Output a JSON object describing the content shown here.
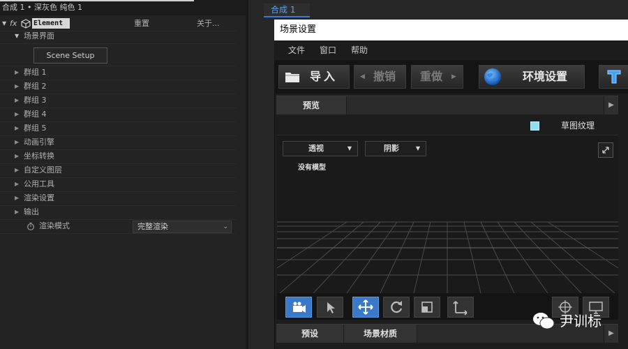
{
  "left_panel": {
    "header": "合成 1 • 深灰色 纯色 1",
    "effect_name": "Element",
    "reset_label": "重置",
    "about_label": "关于...",
    "fx_label": "fx",
    "scene_interface": {
      "label": "场景界面",
      "button_label": "Scene Setup"
    },
    "items": [
      {
        "label": "群组  1"
      },
      {
        "label": "群组  2"
      },
      {
        "label": "群组  3"
      },
      {
        "label": "群组  4"
      },
      {
        "label": "群组  5"
      },
      {
        "label": "动画引擎"
      },
      {
        "label": "坐标转换"
      },
      {
        "label": "自定义图层"
      },
      {
        "label": "公用工具"
      },
      {
        "label": "渲染设置"
      },
      {
        "label": "输出"
      }
    ],
    "render_mode": {
      "label": "渲染模式",
      "value": "完整渲染"
    }
  },
  "comp_tab": "合成 1",
  "window": {
    "title": "场景设置",
    "menu": [
      "文件",
      "窗口",
      "帮助"
    ],
    "toolbar": {
      "import": "导入",
      "undo": "撤销",
      "redo": "重做",
      "env": "环境设置"
    },
    "preview_tab": "预览",
    "texture_label": "草图纹理",
    "view_dropdown": "透视",
    "shade_dropdown": "阴影",
    "no_model": "没有模型",
    "bottom_tabs": [
      "预设",
      "场景材质"
    ]
  },
  "watermark": "尹训标",
  "colors": {
    "accent_blue": "#3a78c8",
    "link_blue": "#4a8fe6",
    "checkbox": "#8fe0f0"
  }
}
